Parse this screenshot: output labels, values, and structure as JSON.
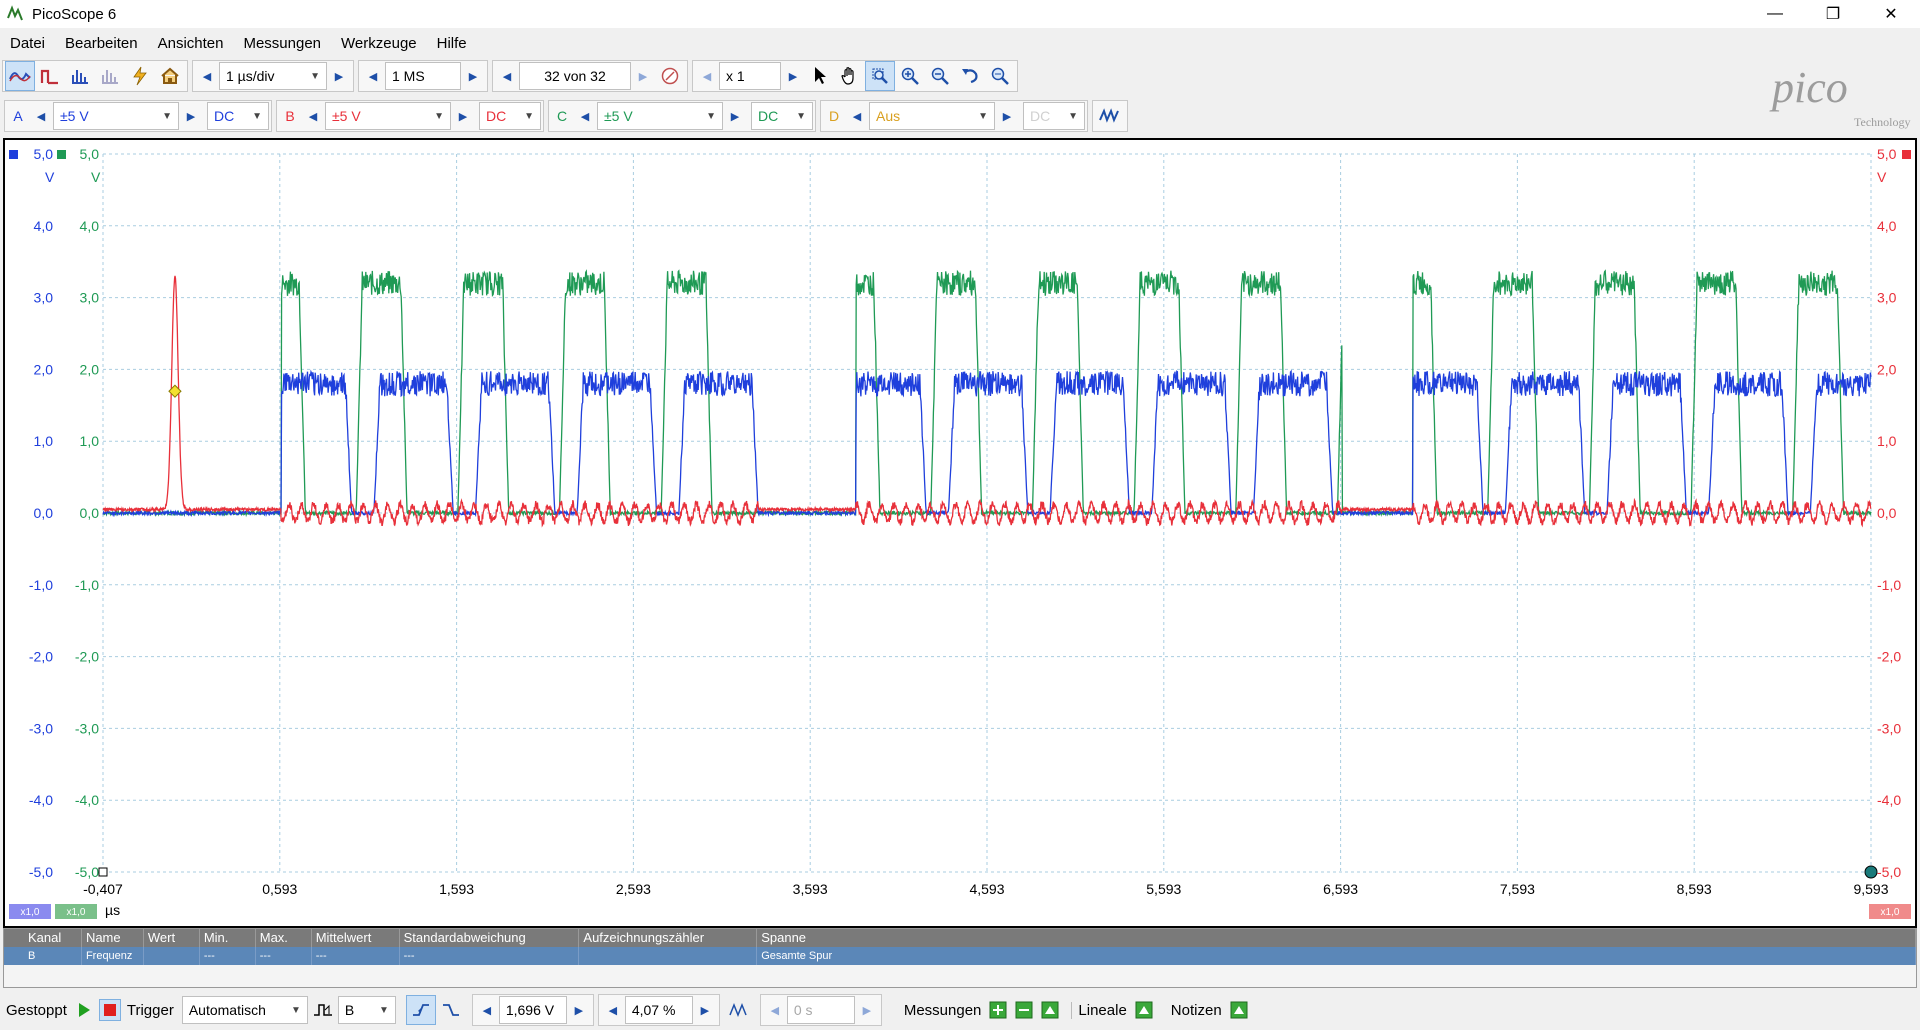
{
  "window": {
    "title": "PicoScope 6",
    "min": "—",
    "max": "❐",
    "close": "✕"
  },
  "menu": [
    "Datei",
    "Bearbeiten",
    "Ansichten",
    "Messungen",
    "Werkzeuge",
    "Hilfe"
  ],
  "toolbar": {
    "timebase": "1 µs/div",
    "samples": "1 MS",
    "capture": "32 von 32",
    "zoom": "x 1"
  },
  "channels": [
    {
      "label": "A",
      "range": "±5 V",
      "coupling": "DC",
      "color": "#1f3fdc"
    },
    {
      "label": "B",
      "range": "±5 V",
      "coupling": "DC",
      "color": "#e8303a"
    },
    {
      "label": "C",
      "range": "±5 V",
      "coupling": "DC",
      "color": "#1f9a55"
    },
    {
      "label": "D",
      "range": "Aus",
      "coupling": "DC",
      "color": "#d9a020"
    }
  ],
  "logo": {
    "brand": "pico",
    "sub": "Technology"
  },
  "scope": {
    "y_left_A": [
      "5,0",
      "4,0",
      "3,0",
      "2,0",
      "1,0",
      "0,0",
      "-1,0",
      "-2,0",
      "-3,0",
      "-4,0",
      "-5,0"
    ],
    "y_left_C": [
      "5,0",
      "4,0",
      "3,0",
      "2,0",
      "1,0",
      "0,0",
      "-1,0",
      "-2,0",
      "-3,0",
      "-4,0",
      "-5,0"
    ],
    "y_right_B": [
      "5,0",
      "4,0",
      "3,0",
      "2,0",
      "1,0",
      "0,0",
      "-1,0",
      "-2,0",
      "-3,0",
      "-4,0",
      "-5,0"
    ],
    "unit_A": "V",
    "unit_C": "V",
    "unit_B": "V",
    "x_ticks": [
      "-0,407",
      "0,593",
      "1,593",
      "2,593",
      "3,593",
      "4,593",
      "5,593",
      "6,593",
      "7,593",
      "8,593",
      "9,593"
    ],
    "x_unit": "µs",
    "scale_A": "x1,0",
    "scale_C": "x1,0",
    "scale_B": "x1,0"
  },
  "table": {
    "headers": [
      "Kanal",
      "Name",
      "Wert",
      "Min.",
      "Max.",
      "Mittelwert",
      "Standardabweichung",
      "Aufzeichnungszähler",
      "Spanne"
    ],
    "row": [
      "B",
      "Frequenz",
      "",
      "---",
      "---",
      "---",
      "---",
      "",
      "Gesamte Spur"
    ]
  },
  "status": {
    "state": "Gestoppt",
    "trigger_label": "Trigger",
    "trigger_mode": "Automatisch",
    "trigger_source": "B",
    "trigger_level": "1,696 V",
    "pre_trigger": "4,07 %",
    "delay": "0 s",
    "measurements": "Messungen",
    "rulers": "Lineale",
    "notes": "Notizen"
  },
  "chart_data": {
    "type": "line",
    "xlim": [
      -0.407,
      9.593
    ],
    "ylim": [
      -5,
      5
    ],
    "xlabel": "µs",
    "series": [
      {
        "name": "A",
        "color": "#1f3fdc",
        "bursts": [
          [
            0.6,
            3.3
          ],
          [
            3.85,
            6.6
          ],
          [
            7.0,
            9.6
          ]
        ],
        "high": 1.8,
        "low": 0.0,
        "period": 0.575,
        "duty": 0.78
      },
      {
        "name": "C",
        "color": "#1f9a55",
        "bursts": [
          [
            0.6,
            3.3
          ],
          [
            3.85,
            6.6
          ],
          [
            7.0,
            9.6
          ]
        ],
        "high": 3.2,
        "low": 0.0,
        "period": 0.575,
        "duty": 0.5
      },
      {
        "name": "B",
        "color": "#e8303a",
        "bursts": [
          [
            0.6,
            3.3
          ],
          [
            3.85,
            6.6
          ],
          [
            7.0,
            9.6
          ]
        ],
        "high": 0.15,
        "low": -0.15,
        "pulse_x": 0.0,
        "pulse_peak": 3.25
      }
    ]
  }
}
